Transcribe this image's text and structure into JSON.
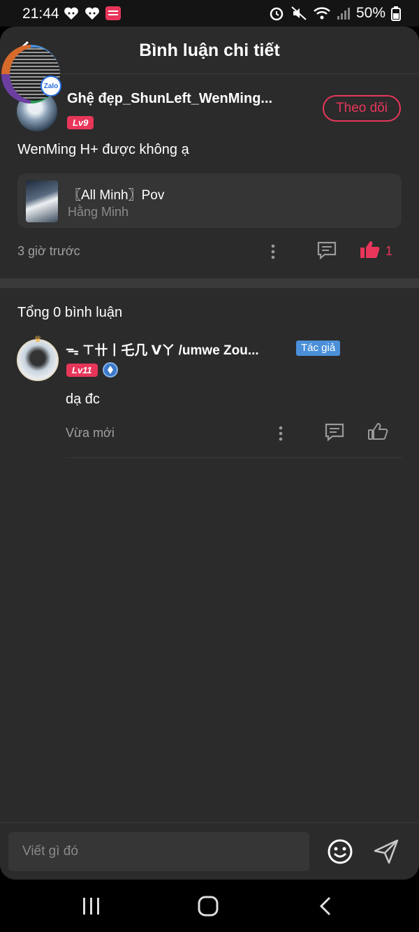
{
  "status_bar": {
    "time": "21:44",
    "battery": "50%",
    "left_icons": [
      "heart-face-icon",
      "heart-face-icon",
      "manga-toon-icon"
    ],
    "right_icons": [
      "alarm-icon",
      "mute-icon",
      "wifi-icon",
      "signal-icon",
      "battery-icon"
    ]
  },
  "header": {
    "title": "Bình luận chi tiết"
  },
  "floating_bubble": {
    "badge": "Zalo"
  },
  "post": {
    "author": "Ghệ đẹp_ShunLeft_WenMing...",
    "level": "Lv9",
    "follow_label": "Theo dõi",
    "content": "WenMing H+ được không ạ",
    "story": {
      "title": "〖All Minh〗Pov",
      "author": "Hằng Minh"
    },
    "time": "3 giờ trước",
    "like_count": "1"
  },
  "comments": {
    "total_label": "Tổng 0 bình luận",
    "items": [
      {
        "author": "ᯓ ⊤卄丨乇几 ᐯㄚ /umwe Zou...",
        "tag": "Tác giả",
        "level": "Lv11",
        "text": "dạ đc",
        "time": "Vừa mới"
      }
    ]
  },
  "input": {
    "placeholder": "Viết gì đó"
  },
  "colors": {
    "accent": "#e8365a",
    "background": "#2b2b2b",
    "tag_blue": "#4a8fd8"
  }
}
